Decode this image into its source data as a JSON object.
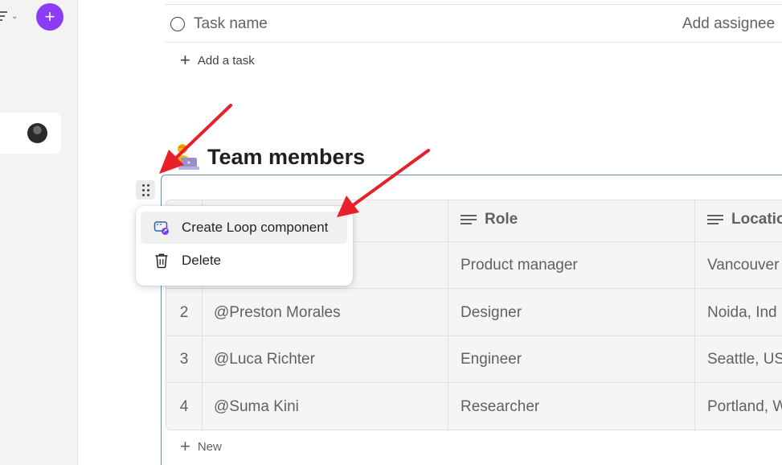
{
  "left_rail": {
    "add_label": "+"
  },
  "tasks": {
    "task_name_placeholder": "Task name",
    "add_assignee_label": "Add assignee",
    "add_task_label": "Add a task"
  },
  "section": {
    "title": "Team members",
    "emoji_icon": "person-at-laptop-emoji-icon"
  },
  "table": {
    "columns": [
      {
        "label": "Role",
        "icon": "text-lines-icon"
      },
      {
        "label": "Locatio",
        "icon": "text-lines-icon"
      }
    ],
    "rows": [
      {
        "num": "",
        "name": "",
        "role": "Product manager",
        "location": "Vancouver"
      },
      {
        "num": "2",
        "name": "@Preston Morales",
        "role": "Designer",
        "location": "Noida, Ind"
      },
      {
        "num": "3",
        "name": "@Luca Richter",
        "role": "Engineer",
        "location": "Seattle, US"
      },
      {
        "num": "4",
        "name": "@Suma Kini",
        "role": "Researcher",
        "location": "Portland, W"
      }
    ],
    "new_row_label": "New"
  },
  "context_menu": {
    "items": [
      {
        "label": "Create Loop component",
        "icon": "loop-component-icon"
      },
      {
        "label": "Delete",
        "icon": "trash-icon"
      }
    ]
  },
  "colors": {
    "accent": "#8b3cf7",
    "arrow": "#e8202a",
    "table_border": "#6b8f9e"
  }
}
